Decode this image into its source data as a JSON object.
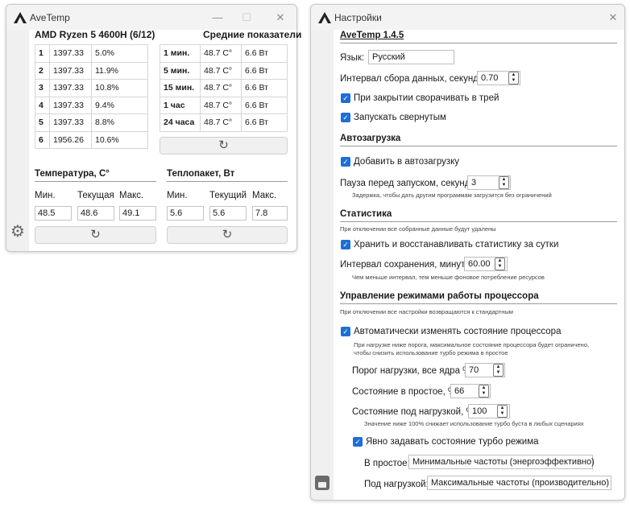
{
  "left_window": {
    "title": "AveTemp",
    "controls": {
      "minimize": "—",
      "maximize": "☐",
      "close": "✕"
    },
    "cpu_name": "AMD Ryzen 5 4600H (6/12)",
    "avg_title": "Средние показатели",
    "cores": [
      [
        "1",
        "1397.33",
        "5.0%"
      ],
      [
        "2",
        "1397.33",
        "11.9%"
      ],
      [
        "3",
        "1397.33",
        "10.8%"
      ],
      [
        "4",
        "1397.33",
        "9.4%"
      ],
      [
        "5",
        "1397.33",
        "8.8%"
      ],
      [
        "6",
        "1956.26",
        "10.6%"
      ]
    ],
    "averages": [
      [
        "1 мин.",
        "48.7 C°",
        "6.6 Вт"
      ],
      [
        "5 мин.",
        "48.7 C°",
        "6.6 Вт"
      ],
      [
        "15 мин.",
        "48.7 C°",
        "6.6 Вт"
      ],
      [
        "1 час",
        "48.7 C°",
        "6.6 Вт"
      ],
      [
        "24 часа",
        "48.7 C°",
        "6.6 Вт"
      ]
    ],
    "temperature": {
      "title": "Температура, С°",
      "min_label": "Мин.",
      "cur_label": "Текущая",
      "max_label": "Макс.",
      "min": "48.5",
      "cur": "48.6",
      "max": "49.1"
    },
    "power": {
      "title": "Теплопакет, Вт",
      "min_label": "Мин.",
      "cur_label": "Текущий",
      "max_label": "Макс.",
      "min": "5.6",
      "cur": "5.6",
      "max": "7.8"
    },
    "refresh_glyph": "↻",
    "settings_glyph": "⚙"
  },
  "settings": {
    "title": "Настройки",
    "close": "✕",
    "version": "AveTemp 1.4.5",
    "language_label": "Язык:",
    "language_value": "Русский",
    "interval_label": "Интервал сбора данных, секунды:",
    "interval_value": "0.70",
    "minimize_tray": "При закрытии сворачивать в трей",
    "start_minimized": "Запускать свернутым",
    "autostart_head": "Автозагрузка",
    "autostart_add": "Добавить в автозагрузку",
    "autostart_pause_label": "Пауза перед запуском, секунды:",
    "autostart_pause_value": "3",
    "autostart_note": "Задержка, чтобы дать другим программам загрузится без ограничений",
    "stats_head": "Статистика",
    "stats_note": "При отключении все собранные данные будут удалены",
    "stats_keep": "Хранить и восстанавливать статистику за сутки",
    "stats_interval_label": "Интервал сохранения, минуты:",
    "stats_interval_value": "60.00",
    "stats_interval_note": "Чем меньше интервал, тем меньше фоновое потребление ресурсов",
    "cpu_head": "Управление режимами работы процессора",
    "cpu_note": "При отключении все настройки возвращаются к стандартным",
    "cpu_auto": "Автоматически изменять состояние процессора",
    "cpu_auto_note1": "При нагрузке ниже порога, максимальное состояние процессора будет ограничено,",
    "cpu_auto_note2": "чтобы снизить использование турбо режима в простое",
    "threshold_label": "Порог нагрузки, все ядра %:",
    "threshold_value": "70",
    "idle_state_label": "Состояние в простое, %:",
    "idle_state_value": "66",
    "load_state_label": "Состояние под нагрузкой, %:",
    "load_state_value": "100",
    "load_state_note": "Значение ниже 100% снижает использование турбо буста в любых сценариях",
    "turbo_explicit": "Явно задавать состояние турбо режима",
    "idle_label": "В простое:",
    "idle_value": "Минимальные частоты (энергоэффективно)",
    "load_label": "Под нагрузкой:",
    "load_value": "Максимальные частоты (производительно)",
    "check_glyph": "✓",
    "spin_up": "▲",
    "spin_down": "▼"
  },
  "colors": {
    "accent": "#1c6fd4",
    "titlebar": "#f3f3f3",
    "rail": "#f0f0f0"
  }
}
